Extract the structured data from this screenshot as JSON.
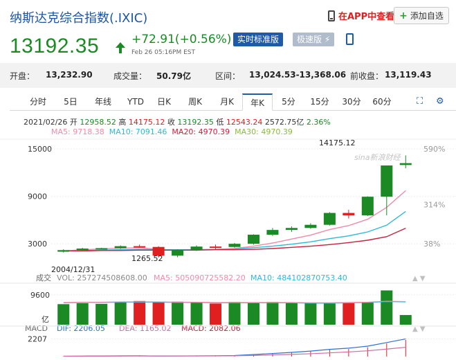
{
  "header": {
    "title": "纳斯达克综合指数(.IXIC)",
    "app_link": "在APP中查看",
    "watch_button": "添加自选",
    "price": "13192.35",
    "change": "+72.91(+0.56%)",
    "price_time": "Feb 26 05:16PM EST",
    "tag_realtime": "实时标准版",
    "tag_fast": "极速版",
    "colors": {
      "up": "#e02020",
      "down": "#1b8a24",
      "link": "#1a56a8"
    }
  },
  "stats": {
    "open_label": "开盘：",
    "open": "13,232.90",
    "volume_label": "成交量：",
    "volume": "50.79亿",
    "range_label": "区间：",
    "range": "13,024.53-13,368.06",
    "prev_label": "前收盘：",
    "prev": "13,119.43"
  },
  "tabs": [
    "分时",
    "5日",
    "年线",
    "YTD",
    "日K",
    "周K",
    "月K",
    "年K",
    "5分",
    "15分",
    "30分",
    "60分"
  ],
  "active_tab": "年K",
  "ohlc": {
    "date": "2021/02/26",
    "open_label": "开",
    "open": "12958.52",
    "high_label": "高",
    "high": "14175.12",
    "close_label": "收",
    "close": "13192.35",
    "low_label": "低",
    "low": "12543.24",
    "amount": "2572.75亿",
    "pct": "2.36%"
  },
  "ma": {
    "ma5": "MA5: 9718.38",
    "ma10": "MA10: 7091.46",
    "ma20": "MA20: 4970.39",
    "ma30": "MA30: 4970.39",
    "colors": {
      "ma5": "#f08aa8",
      "ma10": "#2eb8d8",
      "ma20": "#c8203c",
      "ma30": "#8aba3c"
    }
  },
  "chart_data": {
    "type": "candlestick",
    "y_ticks": [
      "15000",
      "9000",
      "3000"
    ],
    "y_ticks_values": [
      15000,
      9000,
      3000
    ],
    "ylim": [
      1000,
      15700
    ],
    "right_ticks": [
      "590%",
      "314%",
      "38%"
    ],
    "max_label": "14175.12",
    "min_label": "1265.52",
    "start_date": "2004/12/31",
    "watermark": "sina新浪财经",
    "candles": [
      {
        "o": 2000,
        "h": 2300,
        "l": 1900,
        "c": 2200
      },
      {
        "o": 2200,
        "h": 2500,
        "l": 2100,
        "c": 2400
      },
      {
        "o": 2400,
        "h": 2500,
        "l": 2300,
        "c": 2450
      },
      {
        "o": 2450,
        "h": 2800,
        "l": 2350,
        "c": 2700
      },
      {
        "o": 2700,
        "h": 2900,
        "l": 2500,
        "c": 2550
      },
      {
        "o": 2600,
        "h": 2700,
        "l": 1265.52,
        "c": 1500
      },
      {
        "o": 1500,
        "h": 2300,
        "l": 1300,
        "c": 2250
      },
      {
        "o": 2250,
        "h": 2800,
        "l": 2100,
        "c": 2650
      },
      {
        "o": 2650,
        "h": 2900,
        "l": 2300,
        "c": 2600
      },
      {
        "o": 2600,
        "h": 3100,
        "l": 2500,
        "c": 3000
      },
      {
        "o": 3000,
        "h": 4200,
        "l": 2900,
        "c": 4150
      },
      {
        "o": 4150,
        "h": 5000,
        "l": 4000,
        "c": 4750
      },
      {
        "o": 4750,
        "h": 5200,
        "l": 4500,
        "c": 5000
      },
      {
        "o": 5000,
        "h": 5600,
        "l": 4900,
        "c": 5400
      },
      {
        "o": 5400,
        "h": 7000,
        "l": 5300,
        "c": 6900
      },
      {
        "o": 6900,
        "h": 7300,
        "l": 6200,
        "c": 6600
      },
      {
        "o": 6600,
        "h": 9000,
        "l": 6500,
        "c": 8950
      },
      {
        "o": 8950,
        "h": 12900,
        "l": 6600,
        "c": 12900
      },
      {
        "o": 12958.52,
        "h": 14175.12,
        "l": 12543.24,
        "c": 13192.35
      }
    ],
    "ma5": [
      2100,
      2250,
      2350,
      2450,
      2500,
      2300,
      2200,
      2250,
      2300,
      2400,
      2700,
      3100,
      3600,
      4100,
      4800,
      5300,
      6100,
      7600,
      9718.38
    ],
    "ma10": [
      2100,
      2150,
      2200,
      2250,
      2300,
      2250,
      2250,
      2250,
      2300,
      2350,
      2500,
      2700,
      2950,
      3250,
      3650,
      4000,
      4500,
      5350,
      7091.46
    ],
    "ma20": [
      2100,
      2100,
      2150,
      2150,
      2200,
      2200,
      2200,
      2200,
      2250,
      2250,
      2300,
      2400,
      2550,
      2700,
      2900,
      3150,
      3450,
      3900,
      4970.39
    ],
    "volume": {
      "label": "成交",
      "vol": "VOL: 257274508608.00",
      "ma5": "MA5: 505090725582.20",
      "ma10": "MA10: 484102870753.40",
      "tick_top": "9600",
      "tick_unit": "亿",
      "ylim": [
        0,
        12000
      ],
      "values": [
        6600,
        6900,
        6700,
        7400,
        7600,
        7400,
        7400,
        7200,
        6800,
        7300,
        7000,
        7300,
        6900,
        7000,
        6800,
        6900,
        7100,
        11000,
        3100
      ],
      "ma": [
        7000,
        7100,
        7100,
        7200,
        7200,
        7200,
        7100,
        7100,
        7000,
        7000,
        7000,
        7000,
        7000,
        6900,
        6900,
        7000,
        7100,
        7400,
        7300
      ]
    },
    "macd": {
      "label": "MACD",
      "dif": "DIF: 2206.05",
      "dea": "DEA: 1165.02",
      "macd": "MACD: 2082.06",
      "tick_top": "2207",
      "ylim": [
        0,
        2600
      ],
      "dif_values": [
        50,
        60,
        70,
        90,
        100,
        60,
        70,
        90,
        100,
        130,
        250,
        380,
        520,
        680,
        900,
        1050,
        1300,
        1750,
        2206.05
      ],
      "dea_values": [
        40,
        45,
        55,
        65,
        75,
        70,
        70,
        75,
        85,
        100,
        140,
        200,
        270,
        350,
        460,
        580,
        720,
        930,
        1165.02
      ],
      "hist": [
        20,
        30,
        30,
        50,
        50,
        0,
        0,
        30,
        30,
        60,
        220,
        360,
        500,
        660,
        880,
        940,
        1160,
        1640,
        2082.06
      ]
    }
  }
}
